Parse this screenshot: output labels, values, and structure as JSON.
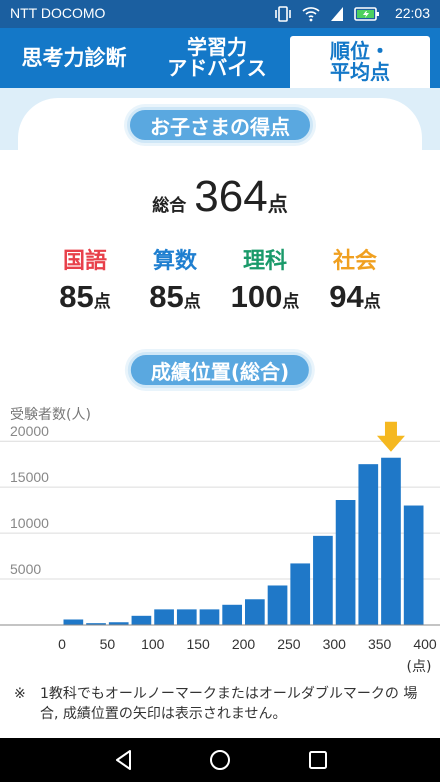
{
  "status_bar": {
    "carrier": "NTT DOCOMO",
    "time": "22:03"
  },
  "tabs": [
    {
      "label": "思考力診断"
    },
    {
      "label": "学習力\nアドバイス"
    },
    {
      "label": "順位・\n平均点",
      "active": true
    }
  ],
  "scores": {
    "heading": "お子さまの得点",
    "total_label": "総合",
    "total_value": "364",
    "unit": "点",
    "subjects": [
      {
        "name": "国語",
        "value": "85",
        "color": "#e8404a"
      },
      {
        "name": "算数",
        "value": "85",
        "color": "#1f7fd0"
      },
      {
        "name": "理科",
        "value": "100",
        "color": "#1a9a6a"
      },
      {
        "name": "社会",
        "value": "94",
        "color": "#f0a020"
      }
    ]
  },
  "ranking": {
    "heading": "成績位置(総合)",
    "ylabel": "受験者数(人)"
  },
  "chart_data": {
    "type": "bar",
    "ylabel": "受験者数(人)",
    "xunit": "(点)",
    "x_ticks": [
      0,
      50,
      100,
      150,
      200,
      250,
      300,
      350,
      400
    ],
    "y_ticks": [
      5000,
      10000,
      15000,
      20000
    ],
    "ylim": [
      0,
      21000
    ],
    "xlim": [
      0,
      400
    ],
    "bin_width": 25,
    "bin_starts": [
      0,
      25,
      50,
      75,
      100,
      125,
      150,
      175,
      200,
      225,
      250,
      275,
      300,
      325,
      350,
      375
    ],
    "values": [
      600,
      200,
      300,
      1000,
      1700,
      1700,
      1700,
      2200,
      2800,
      4300,
      6700,
      9700,
      13600,
      17500,
      18200,
      13000
    ],
    "marker_score": 364,
    "bar_color": "#1f78c8",
    "marker_color": "#f5b820",
    "grid": true
  },
  "note": {
    "mark": "※",
    "text": "1教科でもオールノーマークまたはオールダブルマークの 場合, 成績位置の矢印は表示されません。"
  }
}
